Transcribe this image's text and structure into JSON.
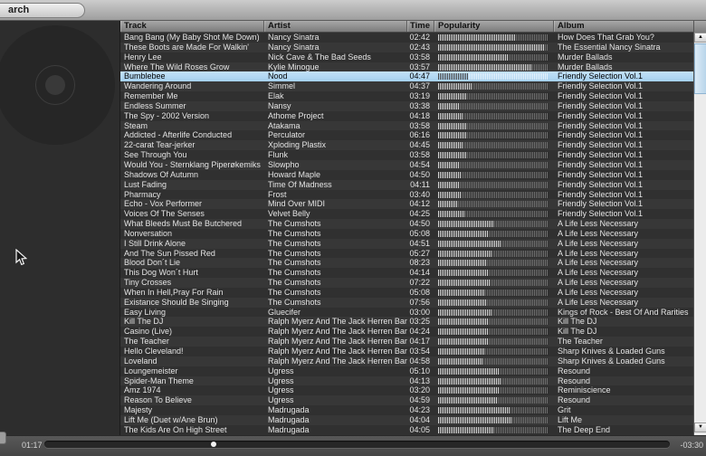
{
  "topbar": {
    "search_label": "arch"
  },
  "colors": {
    "selection_blue": "#a5d0ee",
    "row_dark": "#303030",
    "row_light": "#373737",
    "popularity_filled": "#d8d8d8",
    "popularity_empty": "#6e6e6e",
    "header_gray": "#8c8c8c",
    "left_pane_bg": "#2d2d2d"
  },
  "table": {
    "columns": [
      "Track",
      "Artist",
      "Time",
      "Popularity",
      "Album"
    ],
    "selected_index": 4,
    "rows": [
      {
        "track": "Bang Bang (My Baby Shot Me Down)",
        "artist": "Nancy Sinatra",
        "time": "02:42",
        "popularity": 0.7,
        "album": "How Does That Grab You?"
      },
      {
        "track": "These Boots are Made For Walkin'",
        "artist": "Nancy Sinatra",
        "time": "02:43",
        "popularity": 0.97,
        "album": "The Essential Nancy Sinatra"
      },
      {
        "track": "Henry Lee",
        "artist": "Nick Cave & The Bad Seeds",
        "time": "03:58",
        "popularity": 0.63,
        "album": "Murder Ballads"
      },
      {
        "track": "Where The Wild Roses Grow",
        "artist": "Kylie Minogue",
        "time": "03:57",
        "popularity": 0.85,
        "album": "Murder Ballads"
      },
      {
        "track": "Bumblebee",
        "artist": "Nood",
        "time": "04:47",
        "popularity": 0.27,
        "album": "Friendly Selection Vol.1"
      },
      {
        "track": "Wandering Around",
        "artist": "Simmel",
        "time": "04:37",
        "popularity": 0.3,
        "album": "Friendly Selection Vol.1"
      },
      {
        "track": "Remember Me",
        "artist": "Elak",
        "time": "03:19",
        "popularity": 0.26,
        "album": "Friendly Selection Vol.1"
      },
      {
        "track": "Endless Summer",
        "artist": "Nansy",
        "time": "03:38",
        "popularity": 0.2,
        "album": "Friendly Selection Vol.1"
      },
      {
        "track": "The Spy - 2002 Version",
        "artist": "Athome Project",
        "time": "04:18",
        "popularity": 0.22,
        "album": "Friendly Selection Vol.1"
      },
      {
        "track": "Steam",
        "artist": "Atakama",
        "time": "03:58",
        "popularity": 0.26,
        "album": "Friendly Selection Vol.1"
      },
      {
        "track": "Addicted - Afterlife Conducted",
        "artist": "Perculator",
        "time": "06:16",
        "popularity": 0.25,
        "album": "Friendly Selection Vol.1"
      },
      {
        "track": "22-carat Tear-jerker",
        "artist": "Xploding Plastix",
        "time": "04:45",
        "popularity": 0.23,
        "album": "Friendly Selection Vol.1"
      },
      {
        "track": "See Through You",
        "artist": "Flunk",
        "time": "03:58",
        "popularity": 0.25,
        "album": "Friendly Selection Vol.1"
      },
      {
        "track": "Would You - Sternklang Piperøkemiks",
        "artist": "Slowpho",
        "time": "04:54",
        "popularity": 0.19,
        "album": "Friendly Selection Vol.1"
      },
      {
        "track": "Shadows Of Autumn",
        "artist": "Howard Maple",
        "time": "04:50",
        "popularity": 0.21,
        "album": "Friendly Selection Vol.1"
      },
      {
        "track": "Lust Fading",
        "artist": "Time Of Madness",
        "time": "04:11",
        "popularity": 0.19,
        "album": "Friendly Selection Vol.1"
      },
      {
        "track": "Pharmacy",
        "artist": "Frost",
        "time": "03:40",
        "popularity": 0.21,
        "album": "Friendly Selection Vol.1"
      },
      {
        "track": "Echo - Vox Performer",
        "artist": "Mind Over MIDI",
        "time": "04:12",
        "popularity": 0.18,
        "album": "Friendly Selection Vol.1"
      },
      {
        "track": "Voices Of The Senses",
        "artist": "Velvet Belly",
        "time": "04:25",
        "popularity": 0.24,
        "album": "Friendly Selection Vol.1"
      },
      {
        "track": "What Bleeds Must Be Butchered",
        "artist": "The Cumshots",
        "time": "04:50",
        "popularity": 0.5,
        "album": "A Life Less Necessary"
      },
      {
        "track": "Nonversation",
        "artist": "The Cumshots",
        "time": "05:08",
        "popularity": 0.46,
        "album": "A Life Less Necessary"
      },
      {
        "track": "I Still Drink Alone",
        "artist": "The Cumshots",
        "time": "04:51",
        "popularity": 0.57,
        "album": "A Life Less Necessary"
      },
      {
        "track": "And The Sun Pissed Red",
        "artist": "The Cumshots",
        "time": "05:27",
        "popularity": 0.48,
        "album": "A Life Less Necessary"
      },
      {
        "track": "Blood Don´t Lie",
        "artist": "The Cumshots",
        "time": "08:23",
        "popularity": 0.44,
        "album": "A Life Less Necessary"
      },
      {
        "track": "This Dog Won´t Hurt",
        "artist": "The Cumshots",
        "time": "04:14",
        "popularity": 0.45,
        "album": "A Life Less Necessary"
      },
      {
        "track": "Tiny Crosses",
        "artist": "The Cumshots",
        "time": "07:22",
        "popularity": 0.47,
        "album": "A Life Less Necessary"
      },
      {
        "track": "When In Hell,Pray For Rain",
        "artist": "The Cumshots",
        "time": "05:08",
        "popularity": 0.42,
        "album": "A Life Less Necessary"
      },
      {
        "track": "Existance Should Be Singing",
        "artist": "The Cumshots",
        "time": "07:56",
        "popularity": 0.44,
        "album": "A Life Less Necessary"
      },
      {
        "track": "Easy Living",
        "artist": "Gluecifer",
        "time": "03:00",
        "popularity": 0.48,
        "album": "Kings of Rock - Best Of And Rarities"
      },
      {
        "track": "Kill The DJ",
        "artist": "Ralph Myerz And The Jack Herren Band",
        "time": "03:25",
        "popularity": 0.45,
        "album": "Kill The DJ"
      },
      {
        "track": "Casino (Live)",
        "artist": "Ralph Myerz And The Jack Herren Band",
        "time": "04:24",
        "popularity": 0.45,
        "album": "Kill The DJ"
      },
      {
        "track": "The Teacher",
        "artist": "Ralph Myerz And The Jack Herren Band",
        "time": "04:17",
        "popularity": 0.46,
        "album": "The Teacher"
      },
      {
        "track": "Hello Cleveland!",
        "artist": "Ralph Myerz And The Jack Herren Band",
        "time": "03:54",
        "popularity": 0.42,
        "album": "Sharp Knives & Loaded Guns"
      },
      {
        "track": "Loveland",
        "artist": "Ralph Myerz And The Jack Herren Band",
        "time": "04:58",
        "popularity": 0.41,
        "album": "Sharp Knives & Loaded Guns"
      },
      {
        "track": "Loungemeister",
        "artist": "Ugress",
        "time": "05:10",
        "popularity": 0.55,
        "album": "Resound"
      },
      {
        "track": "Spider-Man Theme",
        "artist": "Ugress",
        "time": "04:13",
        "popularity": 0.57,
        "album": "Resound"
      },
      {
        "track": "Amz 1974",
        "artist": "Ugress",
        "time": "03:20",
        "popularity": 0.55,
        "album": "Reminiscience"
      },
      {
        "track": "Reason To Believe",
        "artist": "Ugress",
        "time": "04:59",
        "popularity": 0.54,
        "album": "Resound"
      },
      {
        "track": "Majesty",
        "artist": "Madrugada",
        "time": "04:23",
        "popularity": 0.65,
        "album": "Grit"
      },
      {
        "track": "Lift Me (Duet w/Ane Brun)",
        "artist": "Madrugada",
        "time": "04:04",
        "popularity": 0.67,
        "album": "Lift Me"
      },
      {
        "track": "The Kids Are On High Street",
        "artist": "Madrugada",
        "time": "04:05",
        "popularity": 0.5,
        "album": "The Deep End"
      }
    ]
  },
  "player": {
    "elapsed": "01:17",
    "remaining": "-03:30",
    "progress_fraction": 0.27
  },
  "icons": {
    "scroll_up": "▲",
    "scroll_down": "▼"
  }
}
